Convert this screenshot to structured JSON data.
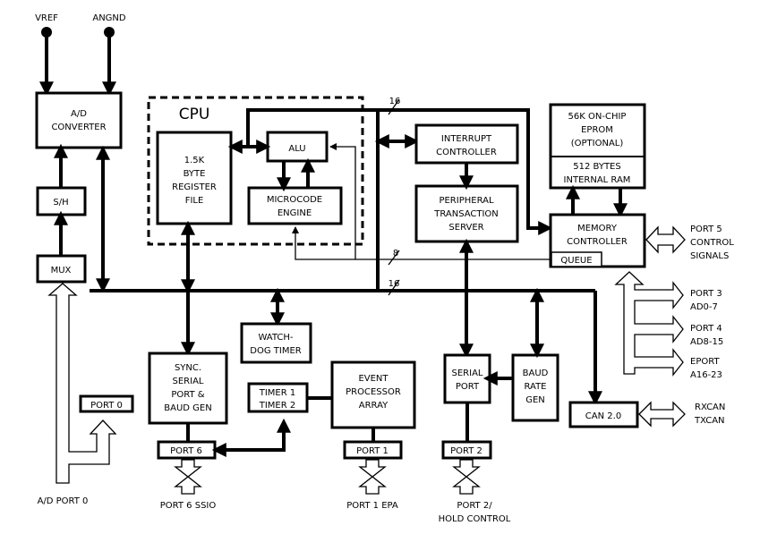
{
  "inputs": {
    "vref": "VREF",
    "angnd": "ANGND"
  },
  "blocks": {
    "ad_converter": [
      "A/D",
      "CONVERTER"
    ],
    "sh": "S/H",
    "mux": "MUX",
    "cpu": "CPU",
    "register_file": [
      "1.5K",
      "BYTE",
      "REGISTER",
      "FILE"
    ],
    "alu": "ALU",
    "microcode": [
      "MICROCODE",
      "ENGINE"
    ],
    "interrupt": [
      "INTERRUPT",
      "CONTROLLER"
    ],
    "pts": [
      "PERIPHERAL",
      "TRANSACTION",
      "SERVER"
    ],
    "eprom": [
      "56K ON-CHIP",
      "EPROM",
      "(OPTIONAL)"
    ],
    "ram": [
      "512 BYTES",
      "INTERNAL RAM"
    ],
    "memory_controller": [
      "MEMORY",
      "CONTROLLER"
    ],
    "queue": "QUEUE",
    "watchdog": [
      "WATCH-",
      "DOG TIMER"
    ],
    "sync_serial": [
      "SYNC.",
      "SERIAL",
      "PORT &",
      "BAUD GEN"
    ],
    "timers": [
      "TIMER 1",
      "TIMER 2"
    ],
    "epa": [
      "EVENT",
      "PROCESSOR",
      "ARRAY"
    ],
    "serial_port": [
      "SERIAL",
      "PORT"
    ],
    "baud": [
      "BAUD",
      "RATE",
      "GEN"
    ],
    "can": "CAN 2.0",
    "port0": "PORT 0",
    "port6": "PORT 6",
    "port1": "PORT 1",
    "port2": "PORT 2"
  },
  "bus_labels": {
    "top": "16",
    "queue": "8",
    "main": "16"
  },
  "external": {
    "port5": [
      "PORT 5",
      "CONTROL",
      "SIGNALS"
    ],
    "port3": [
      "PORT 3",
      "AD0-7"
    ],
    "port4": [
      "PORT 4",
      "AD8-15"
    ],
    "eport": [
      "EPORT",
      "A16-23"
    ],
    "can": [
      "RXCAN",
      "TXCAN"
    ],
    "ad_port0": "A/D PORT 0",
    "port6": "PORT 6 SSIO",
    "port1": "PORT 1 EPA",
    "port2": [
      "PORT 2/",
      "HOLD CONTROL"
    ]
  }
}
